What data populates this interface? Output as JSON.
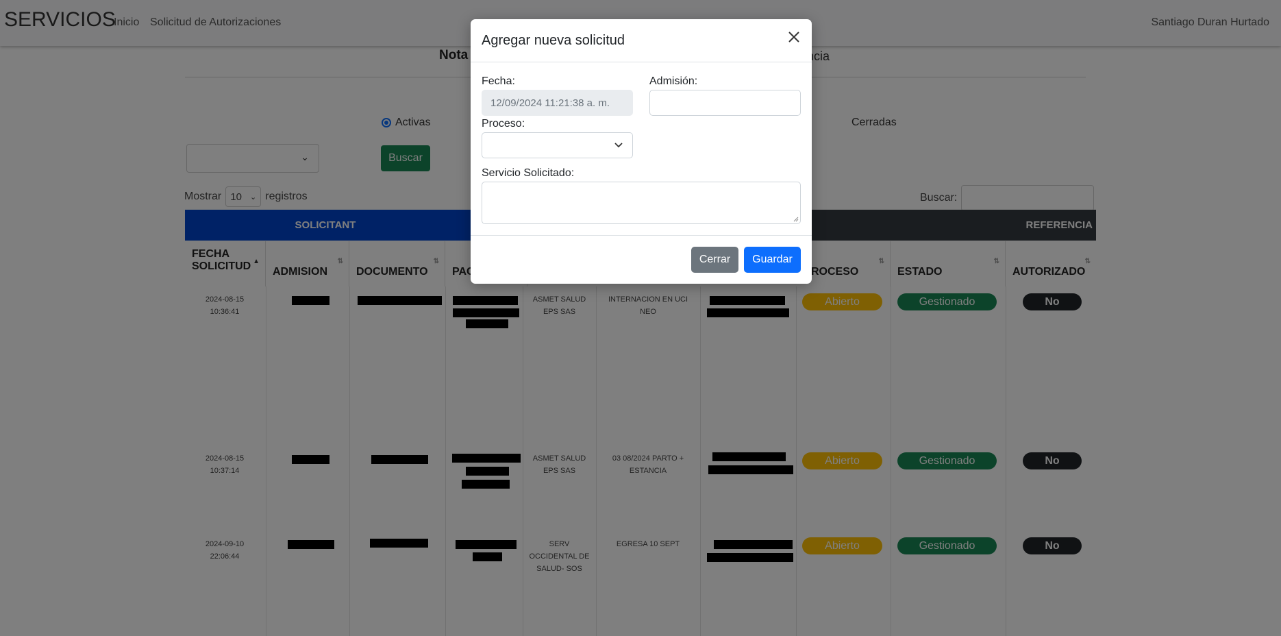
{
  "navbar": {
    "brand": "SERVICIOS",
    "links": [
      "Inicio",
      "Solicitud de Autorizaciones"
    ],
    "user": "Santiago Duran Hurtado"
  },
  "page": {
    "title_left": "Nota",
    "title_right": "ncia",
    "radio_active": "Activas",
    "radio_closed": "Cerradas",
    "search_button": "Buscar",
    "show_label": "Mostrar",
    "show_value": "10",
    "records_label": "registros",
    "search_label": "Buscar:"
  },
  "table": {
    "group_headers": [
      "SOLICITANT",
      "REFERENCIA"
    ],
    "columns": [
      "FECHA SOLICITUD",
      "ADMISION",
      "DOCUMENTO",
      "PAC",
      "ROCESO",
      "ESTADO",
      "AUTORIZADO"
    ],
    "rows": [
      {
        "fecha": "2024-08-15 10:36:41",
        "eps": "ASMET SALUD EPS SAS",
        "servicio": "INTERNACION EN UCI NEO",
        "proceso": "Abierto",
        "estado": "Gestionado",
        "autorizado": "No"
      },
      {
        "fecha": "2024-08-15 10:37:14",
        "eps": "ASMET SALUD EPS SAS",
        "servicio": "03 08/2024 PARTO + ESTANCIA",
        "proceso": "Abierto",
        "estado": "Gestionado",
        "autorizado": "No"
      },
      {
        "fecha": "2024-09-10 22:06:44",
        "eps": "SERV OCCIDENTAL DE SALUD- SOS",
        "servicio": "EGRESA 10 SEPT",
        "proceso": "Abierto",
        "estado": "Gestionado",
        "autorizado": "No"
      }
    ]
  },
  "modal": {
    "title": "Agregar nueva solicitud",
    "fecha_label": "Fecha:",
    "fecha_value": "12/09/2024 11:21:38 a. m.",
    "admision_label": "Admisión:",
    "admision_value": "",
    "proceso_label": "Proceso:",
    "proceso_value": "",
    "servicio_label": "Servicio Solicitado:",
    "servicio_value": "",
    "close_button": "Cerrar",
    "save_button": "Guardar"
  },
  "colors": {
    "primary": "#0d6efd",
    "secondary": "#6c757d",
    "success": "#198754",
    "warning": "#ffc107",
    "group_blue": "#0044cc",
    "group_dark": "#343a40"
  }
}
